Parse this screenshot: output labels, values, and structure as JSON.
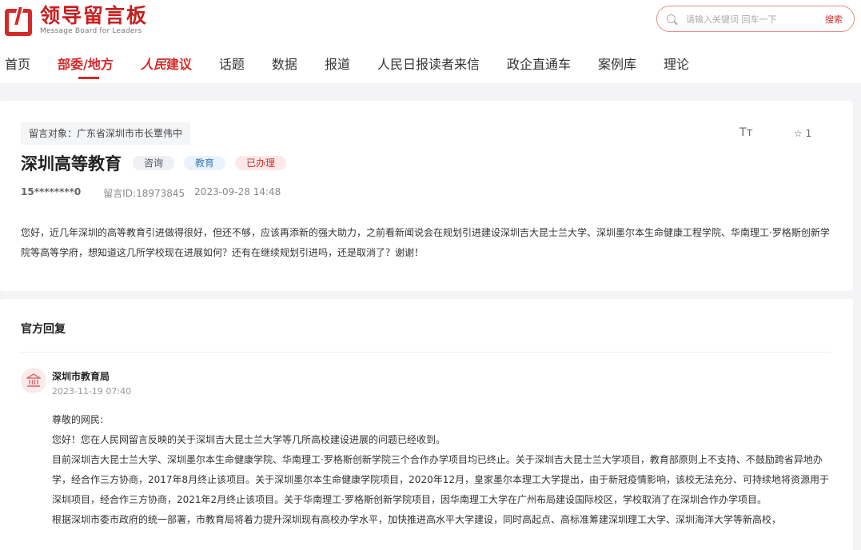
{
  "header": {
    "logo_cn": "领导留言板",
    "logo_en": "Message Board for Leaders",
    "search_placeholder": "请输入关键词 回车一下",
    "search_button": "搜索"
  },
  "nav": {
    "items": [
      "首页",
      "部委/地方",
      "人民",
      "建议",
      "话题",
      "数据",
      "报道",
      "人民日报读者来信",
      "政企直通车",
      "案例库",
      "理论"
    ],
    "active_index": 1
  },
  "message": {
    "target": "留言对象：广东省深圳市市长覃伟中",
    "title": "深圳高等教育",
    "tags": [
      "咨询",
      "教育",
      "已办理"
    ],
    "author": "15********0",
    "message_id": "留言ID:18973845",
    "datetime": "2023-09-28 14:48",
    "fontsize_label": "Tт",
    "favorite_count": "1",
    "content": "您好，近几年深圳的高等教育引进做得很好，但还不够，应该再添新的强大助力，之前看新闻说会在规划引进建设深圳吉大昆士兰大学、深圳墨尔本生命健康工程学院、华南理工·罗格斯创新学院等高等学府，想知道这几所学校现在进展如何？还有在继续规划引进吗，还是取消了？谢谢！"
  },
  "reply": {
    "section_title": "官方回复",
    "org_icon": "bank-icon",
    "org_name": "深圳市教育局",
    "datetime": "2023-11-19 07:40",
    "paragraphs": [
      "尊敬的网民:",
      "您好！您在人民网留言反映的关于深圳吉大昆士兰大学等几所高校建设进展的问题已经收到。",
      "目前深圳吉大昆士兰大学、深圳墨尔本生命健康学院、华南理工·罗格斯创新学院三个合作办学项目均已终止。关于深圳吉大昆士兰大学项目，教育部原则上不支持、不鼓励跨省异地办学，经合作三方协商，2017年8月终止该项目。关于深圳墨尔本生命健康学院项目，2020年12月，皇家墨尔本理工大学提出，由于新冠疫情影响，该校无法充分、可持续地将资源用于深圳项目，经合作三方协商，2021年2月终止该项目。关于华南理工·罗格斯创新学院项目，因华南理工大学在广州布局建设国际校区，学校取消了在深圳合作办学项目。",
      "根据深圳市委市政府的统一部署，市教育局将着力提升深圳现有高校办学水平，加快推进高水平大学建设，同时高起点、高标准筹建深圳理工大学、深圳海洋大学等新高校，"
    ]
  },
  "colors": {
    "brand_red": "#d42a2a",
    "page_bg": "#f4f4f6"
  }
}
